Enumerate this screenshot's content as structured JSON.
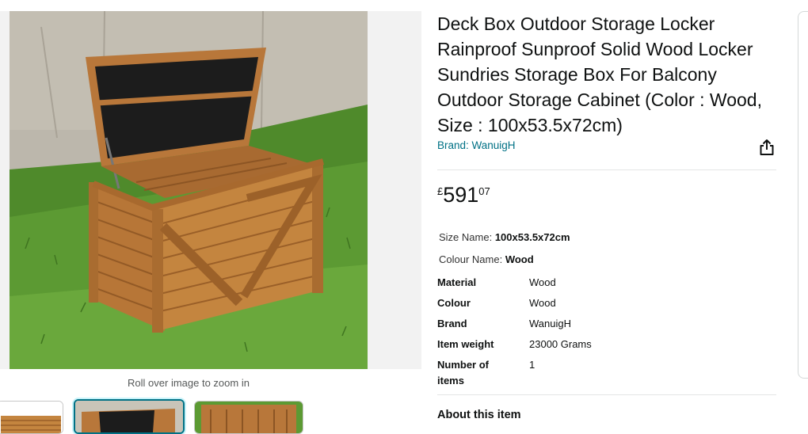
{
  "gallery": {
    "zoom_hint": "Roll over image to zoom in",
    "main_image_icon": "wooden-deck-box-photo",
    "thumbnails": [
      "thumbnail-side-view",
      "thumbnail-open-lid",
      "thumbnail-top-view"
    ]
  },
  "product": {
    "title": "Deck Box Outdoor Storage Locker Rainproof Sunproof Solid Wood Locker Sundries Storage Box For Balcony Outdoor Storage Cabinet (Color : Wood, Size : 100x53.5x72cm)",
    "brand_link": "Brand: WanuigH",
    "share_icon": "share-icon",
    "price": {
      "symbol": "£",
      "whole": "591",
      "fraction": "07"
    },
    "variations": {
      "size_label": "Size Name:",
      "size_value": "100x53.5x72cm",
      "colour_label": "Colour Name:",
      "colour_value": "Wood"
    },
    "specs": [
      {
        "key": "Material",
        "value": "Wood"
      },
      {
        "key": "Colour",
        "value": "Wood"
      },
      {
        "key": "Brand",
        "value": "WanuigH"
      },
      {
        "key": "Item weight",
        "value": "23000 Grams"
      },
      {
        "key": "Number of items",
        "value": "1"
      }
    ],
    "about_heading": "About this item"
  },
  "colors": {
    "link": "#007185",
    "text": "#0f1111",
    "divider": "#e3e6e6"
  }
}
